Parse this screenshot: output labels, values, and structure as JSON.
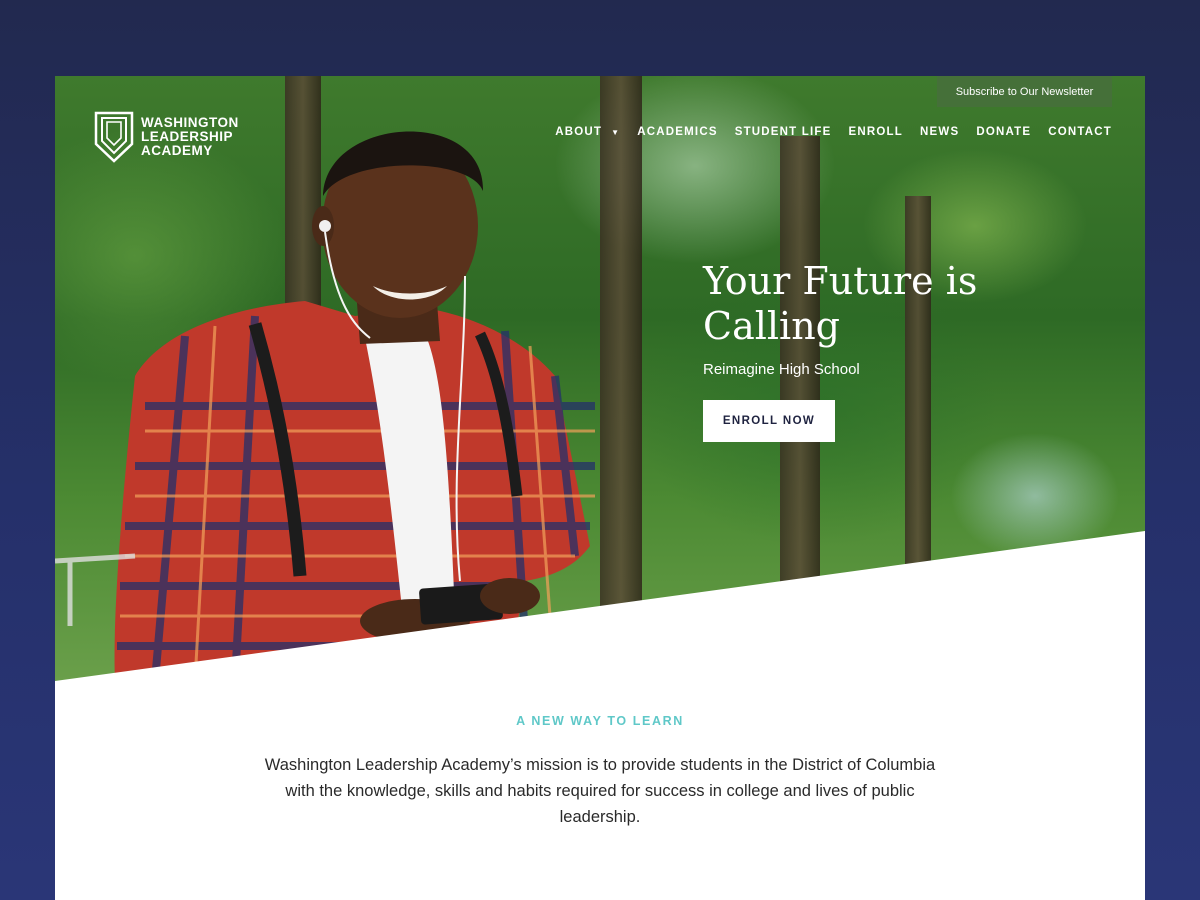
{
  "header": {
    "logo": {
      "lines": [
        "WASHINGTON",
        "LEADERSHIP",
        "ACADEMY"
      ],
      "icon": "shield-logo-icon"
    },
    "newsletter_label": "Subscribe to Our Newsletter",
    "nav": [
      {
        "label": "ABOUT",
        "has_dropdown": true
      },
      {
        "label": "ACADEMICS"
      },
      {
        "label": "STUDENT LIFE"
      },
      {
        "label": "ENROLL"
      },
      {
        "label": "NEWS"
      },
      {
        "label": "DONATE"
      },
      {
        "label": "CONTACT"
      }
    ]
  },
  "hero": {
    "headline": "Your Future is Calling",
    "subhead": "Reimagine High School",
    "cta_label": "ENROLL NOW"
  },
  "intro": {
    "eyebrow": "A NEW WAY TO LEARN",
    "mission": "Washington Leadership Academy’s mission is to provide students in the District of Columbia with the knowledge, skills and habits required for success in college and lives of public leadership."
  },
  "colors": {
    "page_bg": "#24306a",
    "accent": "#5fc8c8",
    "button_text": "#1f2340"
  }
}
